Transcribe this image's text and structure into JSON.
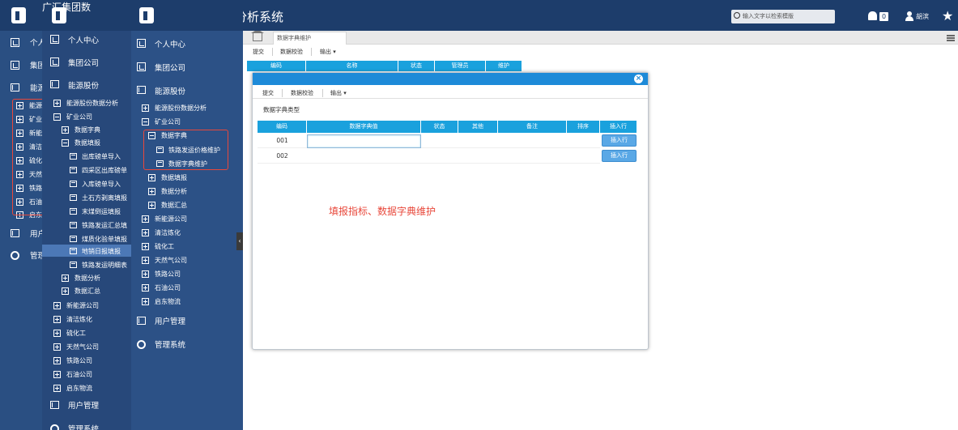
{
  "header": {
    "title_main": "广汇集团数据分析系统",
    "title_short": "广汇集团数",
    "title_tiny": "广",
    "search_placeholder": "输入文字以检索模版",
    "notif_count": "0",
    "user_name": "胡滨"
  },
  "sidebar1": {
    "items": [
      "个人",
      "集团",
      "能源",
      "能源",
      "矿业",
      "新能",
      "清洁",
      "硫化",
      "天然",
      "铁路",
      "石油",
      "启东",
      "用户",
      "管理"
    ]
  },
  "sidebar2": {
    "top": [
      "个人中心",
      "集团公司",
      "能源股份"
    ],
    "tree": [
      "能源股份数据分析",
      "矿业公司",
      "数据字典",
      "数据填报",
      "出库磅单导入",
      "四采区出库磅单",
      "入库磅单导入",
      "土石方剥离填报",
      "末煤倒运填报",
      "铁路发运汇总填",
      "煤质化验单填报",
      "地销日报填报",
      "铁路发运明细表",
      "数据分析",
      "数据汇总",
      "新能源公司",
      "清洁炼化",
      "硫化工",
      "天然气公司",
      "铁路公司",
      "石油公司",
      "启东物流"
    ],
    "bottom": [
      "用户管理",
      "管理系统"
    ]
  },
  "sidebar3": {
    "top": [
      "个人中心",
      "集团公司",
      "能源股份"
    ],
    "tree": [
      "能源股份数据分析",
      "矿业公司",
      "数据字典",
      "铁路发运价格维护",
      "数据字典维护",
      "数据填报",
      "数据分析",
      "数据汇总",
      "新能源公司",
      "清洁炼化",
      "硫化工",
      "天然气公司",
      "铁路公司",
      "石油公司",
      "启东物流"
    ],
    "bottom": [
      "用户管理",
      "管理系统"
    ]
  },
  "main": {
    "tab_label": "数据字典维护",
    "toolbar": [
      "提交",
      "数据校验",
      "输出 ▾"
    ],
    "bg_columns": [
      "编码",
      "名称",
      "状态",
      "管理员",
      "维护"
    ]
  },
  "dialog": {
    "toolbar": [
      "提交",
      "数据校验",
      "输出 ▾"
    ],
    "section_title": "数据字典类型",
    "columns": [
      "编码",
      "数据字典值",
      "状态",
      "其他",
      "备注",
      "排序",
      "插入行"
    ],
    "rows": [
      {
        "code": "001",
        "value": "",
        "action": "插入行"
      },
      {
        "code": "002",
        "value": "",
        "action": "插入行"
      }
    ],
    "annotation": "填报指标、数据字典维护"
  },
  "colors": {
    "accent": "#1aa1dd",
    "sidebar": "#2a4f82",
    "header": "#1d3d6b",
    "highlight": "#e8483b"
  }
}
